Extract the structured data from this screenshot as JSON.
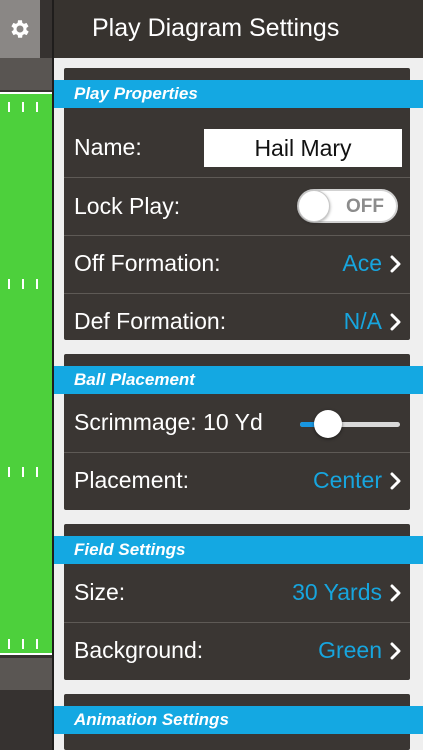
{
  "header": {
    "title": "Play Diagram Settings"
  },
  "groups": {
    "play_properties": {
      "title": "Play Properties",
      "name_label": "Name:",
      "name_value": "Hail Mary",
      "lock_label": "Lock Play:",
      "lock_state": "OFF",
      "off_formation_label": "Off Formation:",
      "off_formation_value": "Ace",
      "def_formation_label": "Def Formation:",
      "def_formation_value": "N/A"
    },
    "ball_placement": {
      "title": "Ball Placement",
      "scrimmage_label": "Scrimmage: 10 Yd",
      "scrimmage_slider_fraction": 0.28,
      "placement_label": "Placement:",
      "placement_value": "Center"
    },
    "field_settings": {
      "title": "Field Settings",
      "size_label": "Size:",
      "size_value": "30 Yards",
      "background_label": "Background:",
      "background_value": "Green"
    },
    "animation_settings": {
      "title": "Animation Settings"
    }
  },
  "colors": {
    "accent": "#14a8e2",
    "value_text": "#17a5de",
    "row_background": "#3a3633",
    "field_green": "#4dd03c"
  },
  "icons": {
    "settings": "gear-icon",
    "disclosure": "chevron-right-icon"
  }
}
